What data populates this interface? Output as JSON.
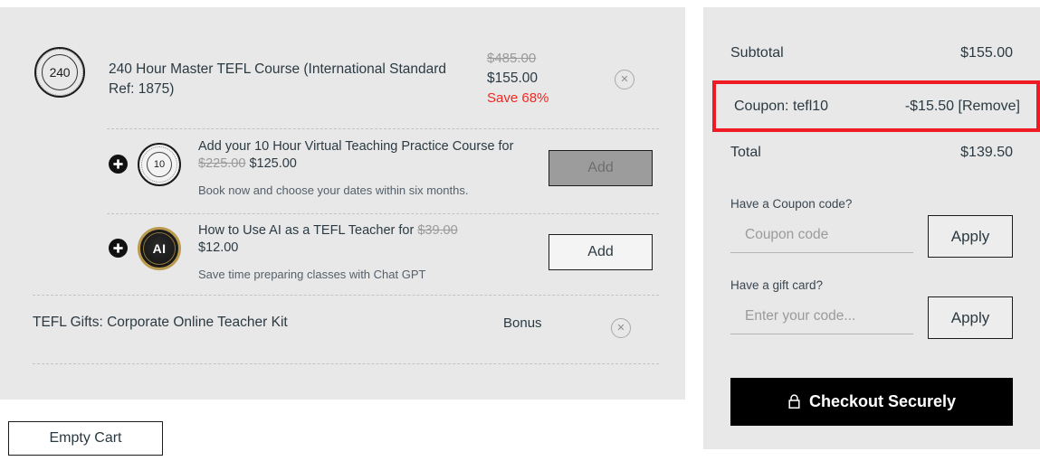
{
  "cart": {
    "main_item": {
      "badge_text": "240",
      "title": "240 Hour Master TEFL Course (International Standard Ref: 1875)",
      "price_original": "$485.00",
      "price_current": "$155.00",
      "save_label": "Save 68%",
      "remove_icon": "close-circle-icon"
    },
    "addons": [
      {
        "badge_text": "10",
        "plus_icon": "plus-circle-icon",
        "headline_prefix": "Add your 10 Hour Virtual Teaching Practice Course for ",
        "price_original": "$225.00",
        "price_current": " $125.00",
        "description": "Book now and choose your dates within six months.",
        "button_label": "Add",
        "button_state": "disabled"
      },
      {
        "badge_text": "AI",
        "plus_icon": "plus-circle-icon",
        "headline_prefix": "How to Use AI as a TEFL Teacher for ",
        "price_original": "$39.00",
        "price_current": "$12.00",
        "description": "Save time preparing classes with Chat GPT",
        "button_label": "Add",
        "button_state": "active"
      }
    ],
    "bonus_item": {
      "title": "TEFL Gifts: Corporate Online Teacher Kit",
      "tag": "Bonus",
      "remove_icon": "close-circle-icon"
    },
    "empty_cart_label": "Empty Cart"
  },
  "summary": {
    "subtotal_label": "Subtotal",
    "subtotal_value": "$155.00",
    "coupon_label": "Coupon: tefl10",
    "coupon_value": "-$15.50 [Remove]",
    "total_label": "Total",
    "total_value": "$139.50",
    "coupon_field": {
      "label": "Have a Coupon code?",
      "placeholder": "Coupon code",
      "value": "",
      "apply_label": "Apply"
    },
    "gift_field": {
      "label": "Have a gift card?",
      "placeholder": "Enter your code...",
      "value": "",
      "apply_label": "Apply"
    },
    "checkout_label": "Checkout Securely",
    "checkout_icon": "lock-icon",
    "highlight_color": "#ee1b24"
  }
}
